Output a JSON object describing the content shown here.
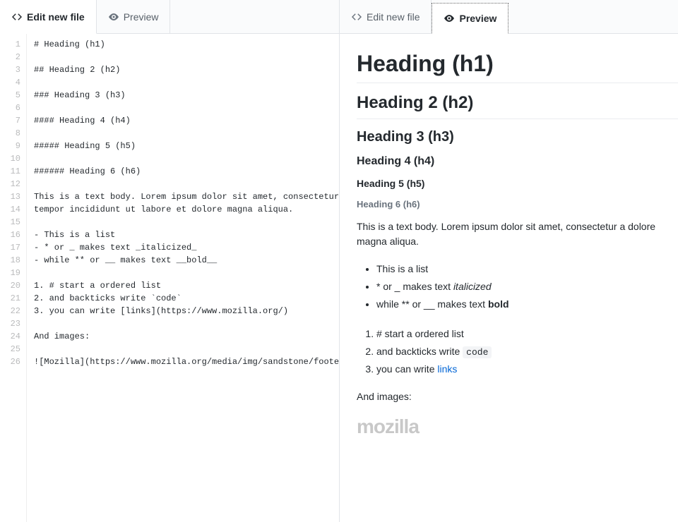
{
  "tabs": {
    "edit": "Edit new file",
    "preview": "Preview"
  },
  "editor": {
    "lines": [
      "# Heading (h1)",
      "",
      "## Heading 2 (h2)",
      "",
      "### Heading 3 (h3)",
      "",
      "#### Heading 4 (h4)",
      "",
      "##### Heading 5 (h5)",
      "",
      "###### Heading 6 (h6)",
      "",
      "This is a text body. Lorem ipsum dolor sit amet, consectetur a",
      "tempor incididunt ut labore et dolore magna aliqua.",
      "",
      "- This is a list",
      "- * or _ makes text _italicized_",
      "- while ** or __ makes text __bold__",
      "",
      "1. # start a ordered list",
      "2. and backticks write `code`",
      "3. you can write [links](https://www.mozilla.org/)",
      "",
      "And images:",
      "",
      "![Mozilla](https://www.mozilla.org/media/img/sandstone/footer-"
    ]
  },
  "preview": {
    "h1": "Heading (h1)",
    "h2": "Heading 2 (h2)",
    "h3": "Heading 3 (h3)",
    "h4": "Heading 4 (h4)",
    "h5": "Heading 5 (h5)",
    "h6": "Heading 6 (h6)",
    "body": "This is a text body. Lorem ipsum dolor sit amet, consectetur a dolore magna aliqua.",
    "ul": {
      "item1": "This is a list",
      "item2_pre": "* or _ makes text ",
      "item2_em": "italicized",
      "item3_pre": "while ** or __ makes text ",
      "item3_strong": "bold"
    },
    "ol": {
      "item1": "# start a ordered list",
      "item2_pre": "and backticks write ",
      "item2_code": "code",
      "item3_pre": "you can write ",
      "item3_link": "links"
    },
    "images_label": "And images:",
    "mozilla": "mozilla"
  }
}
